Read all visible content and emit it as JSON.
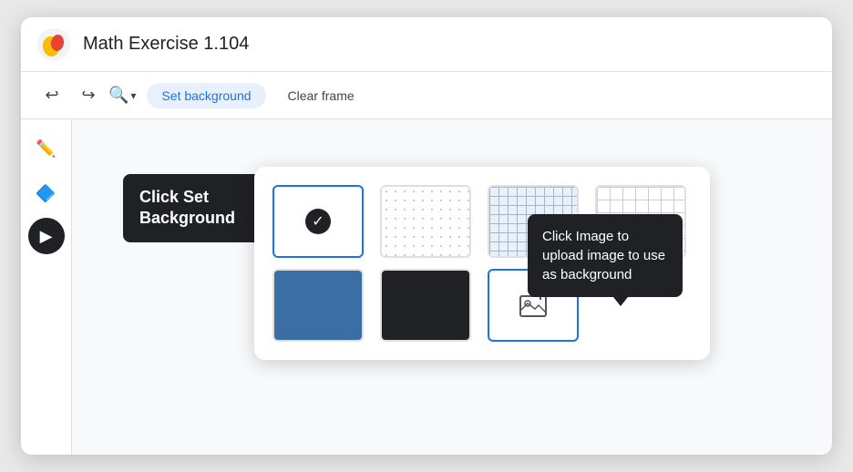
{
  "app": {
    "title": "Math Exercise 1.104"
  },
  "toolbar": {
    "undo_label": "↩",
    "redo_label": "↪",
    "zoom_icon": "⊕",
    "set_background_label": "Set background",
    "clear_frame_label": "Clear frame"
  },
  "tooltips": {
    "set_background": "Click Set Background",
    "click_image": "Click Image to upload image to use as background"
  },
  "sidebar": {
    "pen_icon": "✏",
    "eraser_icon": "◆",
    "cursor_icon": "▶"
  },
  "backgrounds": {
    "options": [
      {
        "id": "white",
        "type": "white",
        "selected": true
      },
      {
        "id": "dots",
        "type": "dots",
        "selected": false
      },
      {
        "id": "grid-blue",
        "type": "grid-blue",
        "selected": false
      },
      {
        "id": "dark-grid",
        "type": "dark-grid",
        "selected": false
      },
      {
        "id": "solid-blue",
        "type": "solid-blue",
        "selected": false
      },
      {
        "id": "solid-black",
        "type": "solid-black",
        "selected": false
      },
      {
        "id": "upload",
        "type": "upload",
        "selected": false
      }
    ]
  },
  "colors": {
    "accent": "#1a73e8",
    "dark": "#202124",
    "tooltip_bg": "#202124"
  }
}
